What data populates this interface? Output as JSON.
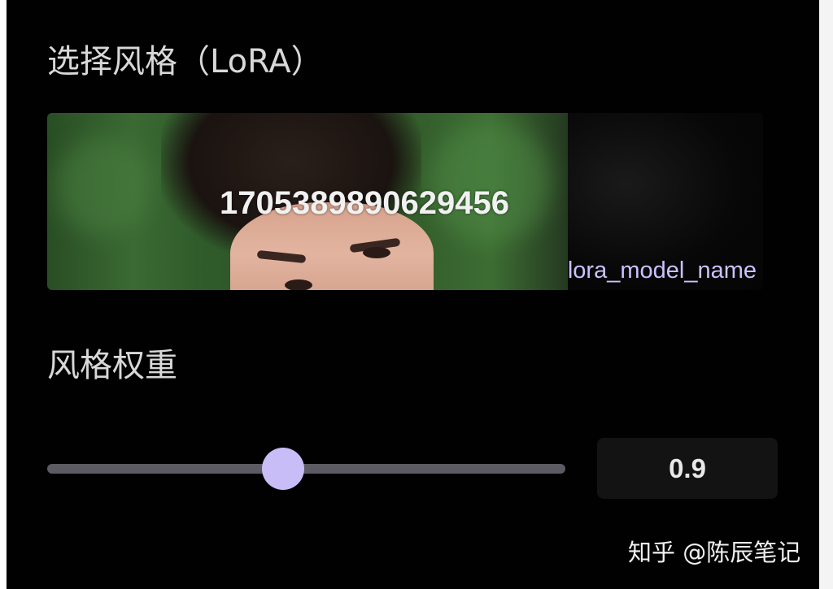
{
  "lora_section": {
    "title": "选择风格（LoRA）",
    "card": {
      "id_text": "1705389890629456",
      "model_name": "lora_model_name"
    }
  },
  "weight_section": {
    "title": "风格权重",
    "slider": {
      "value": 0.9,
      "fill_fraction": 0.456
    },
    "value_text": "0.9"
  },
  "watermark": "知乎 @陈辰笔记",
  "colors": {
    "background": "#010101",
    "thumb": "#c8bdf6",
    "track": "#5c5a62",
    "model_name": "#c9c2ff"
  }
}
